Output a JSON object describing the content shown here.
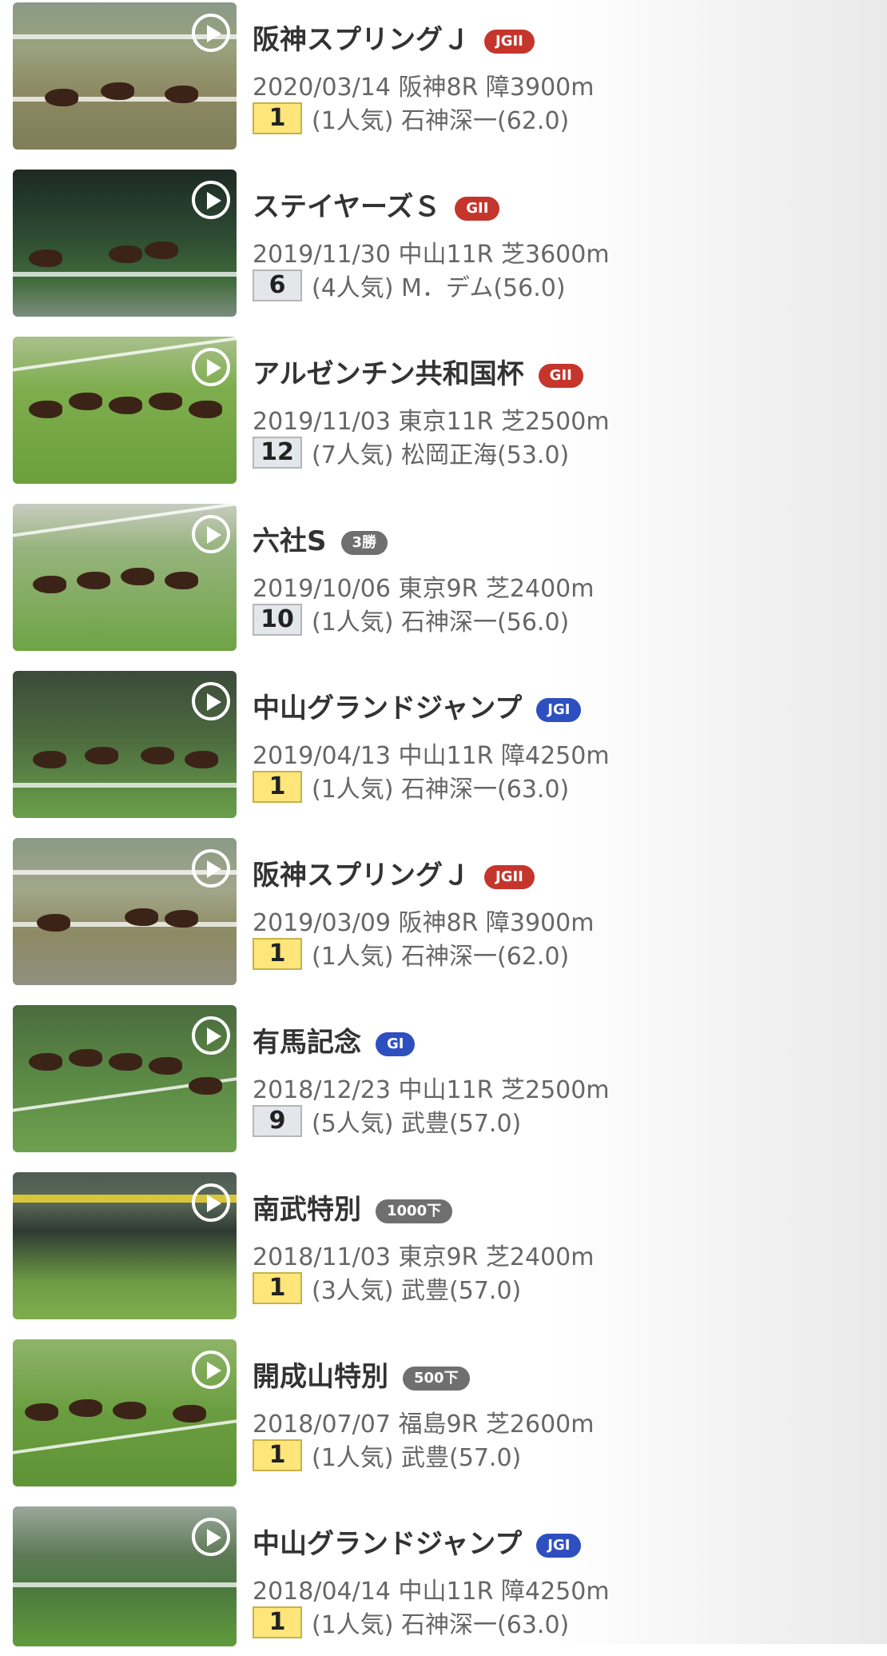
{
  "races": [
    {
      "title": "阪神スプリングＪ",
      "grade": "JGII",
      "grade_color": "red",
      "meta": "2020/03/14 阪神8R 障3900m",
      "position": "1",
      "win": true,
      "detail": "(1人気) 石神深一(62.0)"
    },
    {
      "title": "ステイヤーズＳ",
      "grade": "GII",
      "grade_color": "red",
      "meta": "2019/11/30 中山11R 芝3600m",
      "position": "6",
      "win": false,
      "detail": "(4人気) M．デム(56.0)"
    },
    {
      "title": "アルゼンチン共和国杯",
      "grade": "GII",
      "grade_color": "red",
      "meta": "2019/11/03 東京11R 芝2500m",
      "position": "12",
      "win": false,
      "detail": "(7人気) 松岡正海(53.0)"
    },
    {
      "title": "六社S",
      "grade": "3勝",
      "grade_color": "gray",
      "meta": "2019/10/06 東京9R 芝2400m",
      "position": "10",
      "win": false,
      "detail": "(1人気) 石神深一(56.0)"
    },
    {
      "title": "中山グランドジャンプ",
      "grade": "JGI",
      "grade_color": "blue",
      "meta": "2019/04/13 中山11R 障4250m",
      "position": "1",
      "win": true,
      "detail": "(1人気) 石神深一(63.0)"
    },
    {
      "title": "阪神スプリングＪ",
      "grade": "JGII",
      "grade_color": "red",
      "meta": "2019/03/09 阪神8R 障3900m",
      "position": "1",
      "win": true,
      "detail": "(1人気) 石神深一(62.0)"
    },
    {
      "title": "有馬記念",
      "grade": "GI",
      "grade_color": "blue",
      "meta": "2018/12/23 中山11R 芝2500m",
      "position": "9",
      "win": false,
      "detail": "(5人気) 武豊(57.0)"
    },
    {
      "title": "南武特別",
      "grade": "1000下",
      "grade_color": "gray",
      "meta": "2018/11/03 東京9R 芝2400m",
      "position": "1",
      "win": true,
      "detail": "(3人気) 武豊(57.0)"
    },
    {
      "title": "開成山特別",
      "grade": "500下",
      "grade_color": "gray",
      "meta": "2018/07/07 福島9R 芝2600m",
      "position": "1",
      "win": true,
      "detail": "(1人気) 武豊(57.0)"
    },
    {
      "title": "中山グランドジャンプ",
      "grade": "JGI",
      "grade_color": "blue",
      "meta": "2018/04/14 中山11R 障4250m",
      "position": "1",
      "win": true,
      "detail": "(1人気) 石神深一(63.0)"
    }
  ]
}
